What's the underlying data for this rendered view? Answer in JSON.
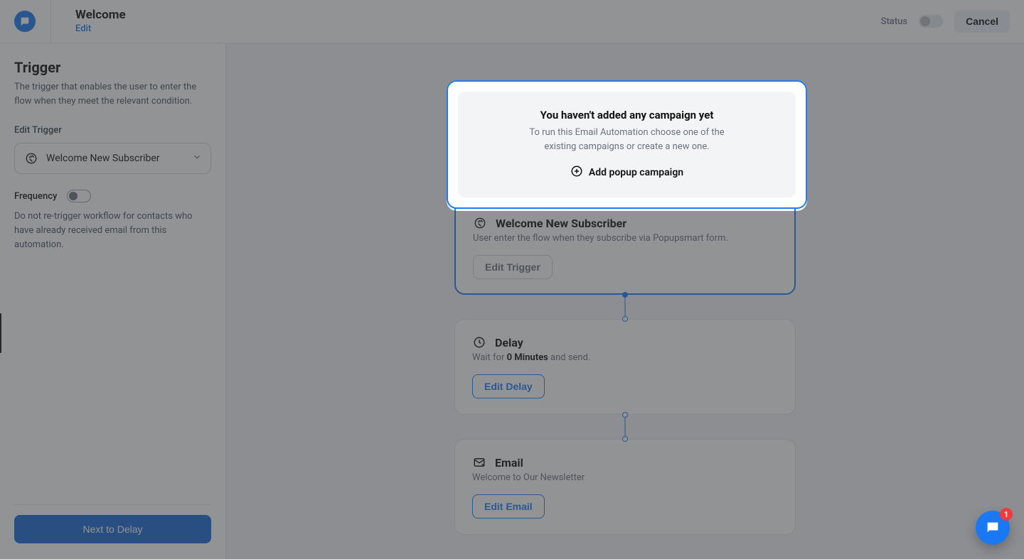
{
  "header": {
    "title": "Welcome",
    "subtitle": "Edit",
    "status_label": "Status",
    "cancel_label": "Cancel"
  },
  "sidebar": {
    "heading": "Trigger",
    "description": "The trigger that enables the user to enter the flow when they meet the relevant condition.",
    "edit_trigger_label": "Edit Trigger",
    "trigger_value": "Welcome New Subscriber",
    "frequency_label": "Frequency",
    "frequency_note": "Do not re-trigger workflow for contacts who have already received email from this automation.",
    "next_button": "Next to Delay"
  },
  "flow": {
    "empty": {
      "heading": "You haven't added any campaign yet",
      "body": "To run this Email Automation choose one of the existing campaigns or create a new one.",
      "add_label": "Add popup campaign"
    },
    "trigger": {
      "title": "Welcome New Subscriber",
      "subtitle": "User enter the flow when they subscribe via Popupsmart form.",
      "button": "Edit Trigger"
    },
    "delay": {
      "title": "Delay",
      "wait_prefix": "Wait for ",
      "wait_value": "0 Minutes",
      "wait_suffix": " and send.",
      "button": "Edit Delay"
    },
    "email": {
      "title": "Email",
      "subtitle": "Welcome to Our Newsletter",
      "button": "Edit Email"
    }
  },
  "chat": {
    "badge": "1"
  }
}
